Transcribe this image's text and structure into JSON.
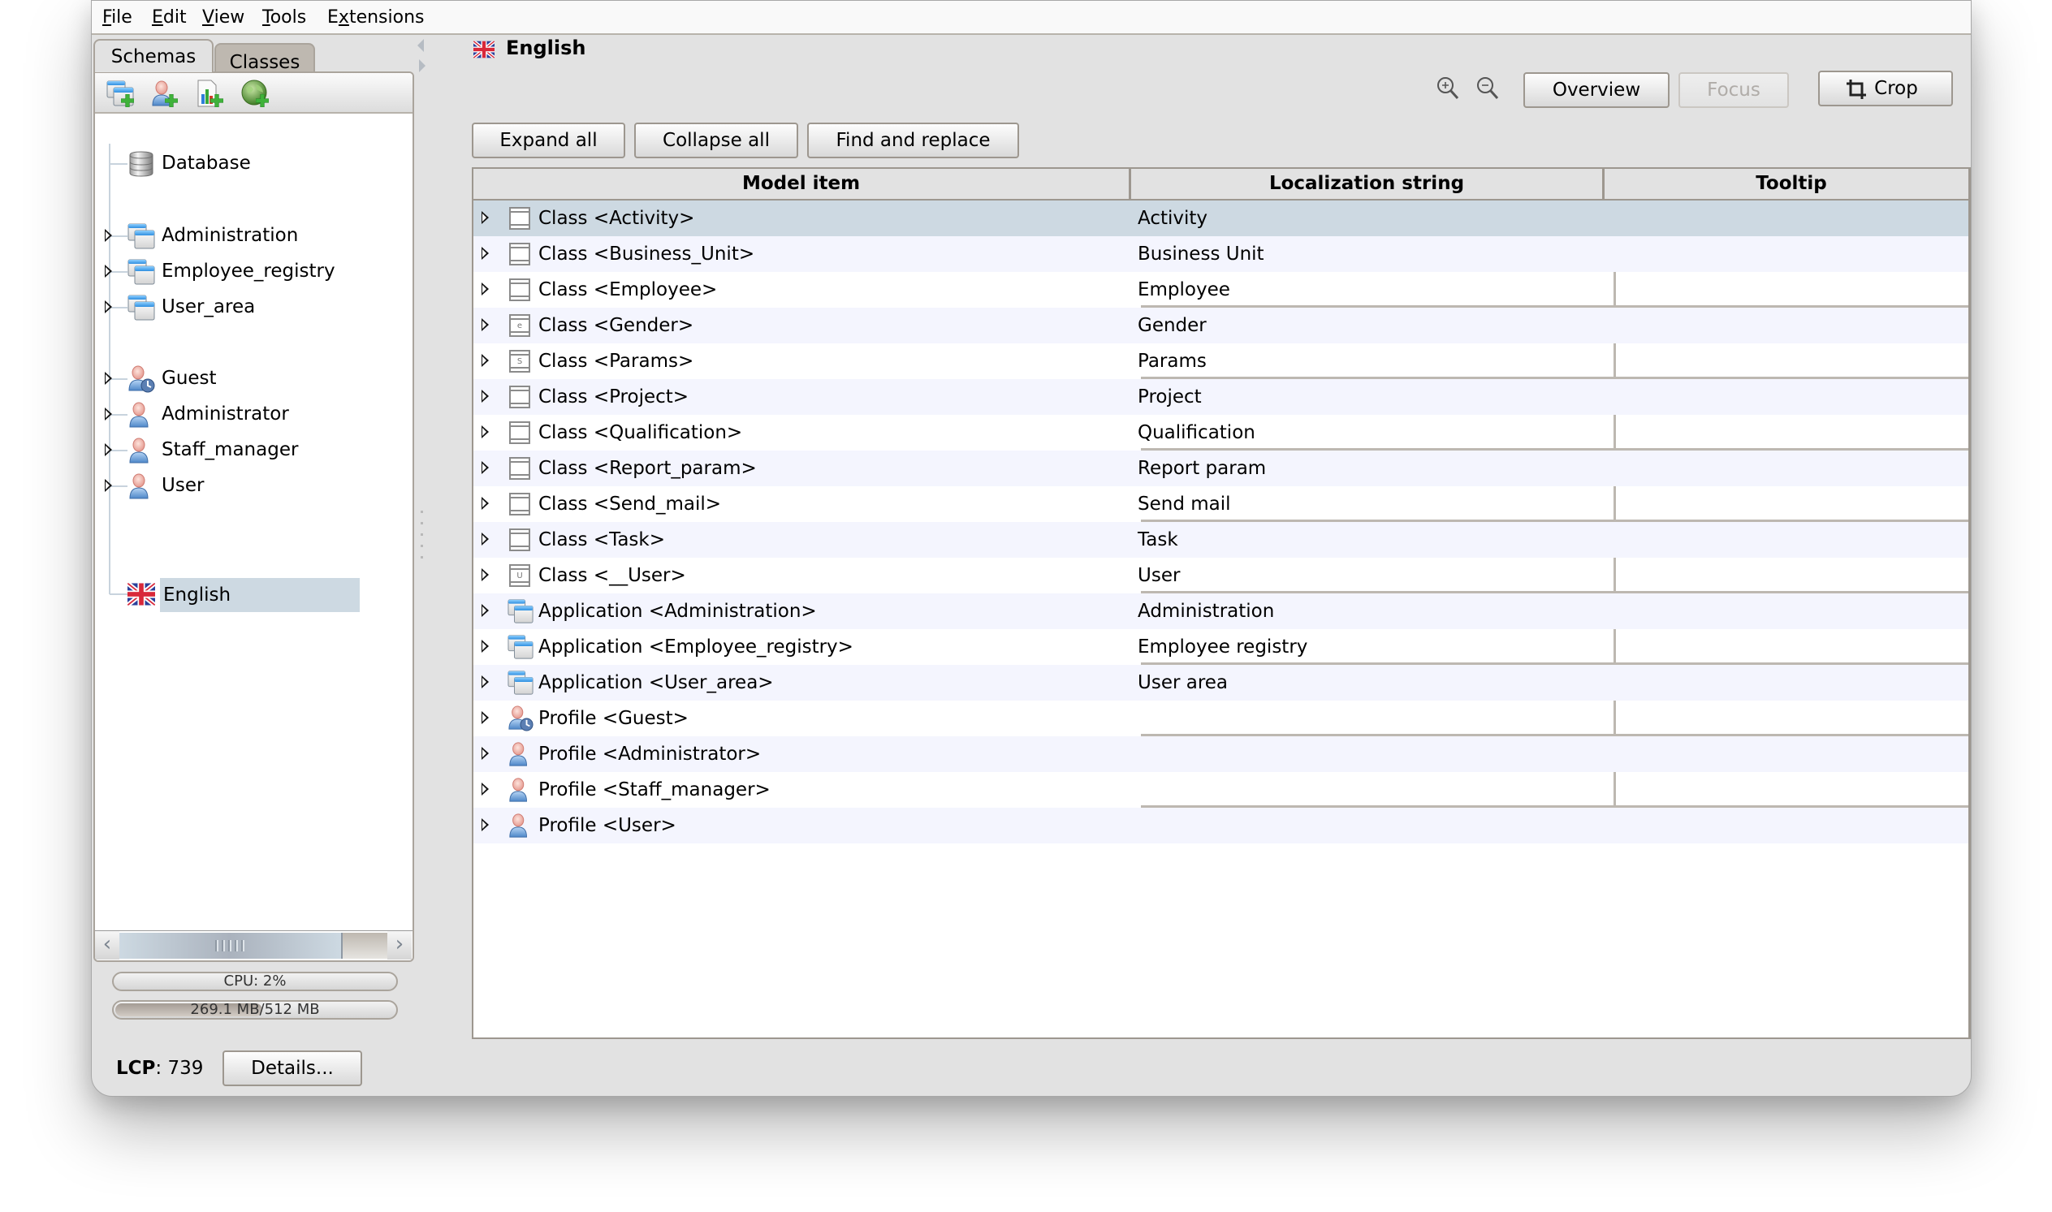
{
  "menu": [
    "File",
    "Edit",
    "View",
    "Tools",
    "Extensions"
  ],
  "menu_mnemonics": [
    "F",
    "E",
    "V",
    "T",
    "x"
  ],
  "left_tabs": [
    {
      "label": "Schemas",
      "active": true
    },
    {
      "label": "Classes",
      "active": false
    }
  ],
  "left_toolbar": [
    {
      "icon": "add-application-icon",
      "tooltip": ""
    },
    {
      "icon": "add-profile-icon",
      "tooltip": ""
    },
    {
      "icon": "add-report-icon",
      "tooltip": ""
    },
    {
      "icon": "add-localization-icon",
      "tooltip": ""
    }
  ],
  "tree": {
    "database": {
      "label": "Database",
      "icon": "database-icon"
    },
    "applications": [
      {
        "label": "Administration",
        "icon": "application-icon"
      },
      {
        "label": "Employee_registry",
        "icon": "application-icon"
      },
      {
        "label": "User_area",
        "icon": "application-icon"
      }
    ],
    "profiles": [
      {
        "label": "Guest",
        "icon": "guest-profile-icon"
      },
      {
        "label": "Administrator",
        "icon": "profile-icon"
      },
      {
        "label": "Staff_manager",
        "icon": "profile-icon"
      },
      {
        "label": "User",
        "icon": "profile-icon"
      }
    ],
    "localizations": [
      {
        "label": "English",
        "icon": "uk-flag-icon",
        "selected": true
      }
    ]
  },
  "status": {
    "cpu_label": "CPU: 2%",
    "cpu_percent": 2,
    "memory_label": "269.1 MB/512 MB",
    "memory_used_mb": 269.1,
    "memory_total_mb": 512,
    "lcp_label": "LCP",
    "lcp_value": ": 739",
    "details_button": "Details..."
  },
  "pane": {
    "title": "English",
    "title_icon": "uk-flag-icon",
    "zoom_in_icon": "zoom-in-icon",
    "zoom_out_icon": "zoom-out-icon",
    "overview_button": "Overview",
    "focus_button": "Focus",
    "focus_enabled": false,
    "crop_button": "Crop",
    "expand_all_button": "Expand all",
    "collapse_all_button": "Collapse all",
    "find_replace_button": "Find and replace"
  },
  "table": {
    "columns": [
      "Model item",
      "Localization string",
      "Tooltip"
    ],
    "rows": [
      {
        "item": "Class <Activity>",
        "icon": "class",
        "glyph": "",
        "localization": "Activity",
        "tooltip": "",
        "selected": true
      },
      {
        "item": "Class <Business_Unit>",
        "icon": "class",
        "glyph": "",
        "localization": "Business Unit",
        "tooltip": ""
      },
      {
        "item": "Class <Employee>",
        "icon": "class",
        "glyph": "",
        "localization": "Employee",
        "tooltip": ""
      },
      {
        "item": "Class <Gender>",
        "icon": "class",
        "glyph": "e",
        "localization": "Gender",
        "tooltip": ""
      },
      {
        "item": "Class <Params>",
        "icon": "class",
        "glyph": "S",
        "localization": "Params",
        "tooltip": ""
      },
      {
        "item": "Class <Project>",
        "icon": "class",
        "glyph": "",
        "localization": "Project",
        "tooltip": ""
      },
      {
        "item": "Class <Qualification>",
        "icon": "class",
        "glyph": "",
        "localization": "Qualification",
        "tooltip": ""
      },
      {
        "item": "Class <Report_param>",
        "icon": "class",
        "glyph": "",
        "localization": "Report param",
        "tooltip": ""
      },
      {
        "item": "Class <Send_mail>",
        "icon": "class",
        "glyph": "",
        "localization": "Send mail",
        "tooltip": ""
      },
      {
        "item": "Class <Task>",
        "icon": "class",
        "glyph": "",
        "localization": "Task",
        "tooltip": ""
      },
      {
        "item": "Class <__User>",
        "icon": "class",
        "glyph": "U",
        "localization": "User",
        "tooltip": ""
      },
      {
        "item": "Application <Administration>",
        "icon": "application",
        "glyph": "",
        "localization": "Administration",
        "tooltip": ""
      },
      {
        "item": "Application <Employee_registry>",
        "icon": "application",
        "glyph": "",
        "localization": "Employee registry",
        "tooltip": ""
      },
      {
        "item": "Application <User_area>",
        "icon": "application",
        "glyph": "",
        "localization": "User area",
        "tooltip": ""
      },
      {
        "item": "Profile <Guest>",
        "icon": "guest",
        "glyph": "",
        "localization": "",
        "tooltip": ""
      },
      {
        "item": "Profile <Administrator>",
        "icon": "profile",
        "glyph": "",
        "localization": "",
        "tooltip": ""
      },
      {
        "item": "Profile <Staff_manager>",
        "icon": "profile",
        "glyph": "",
        "localization": "",
        "tooltip": ""
      },
      {
        "item": "Profile <User>",
        "icon": "profile",
        "glyph": "",
        "localization": "",
        "tooltip": ""
      }
    ]
  },
  "colors": {
    "selection": "#cdd9e2",
    "alt_row": "#f4f5fe",
    "window_bg": "#e2e2e2",
    "border": "#9d978f"
  }
}
